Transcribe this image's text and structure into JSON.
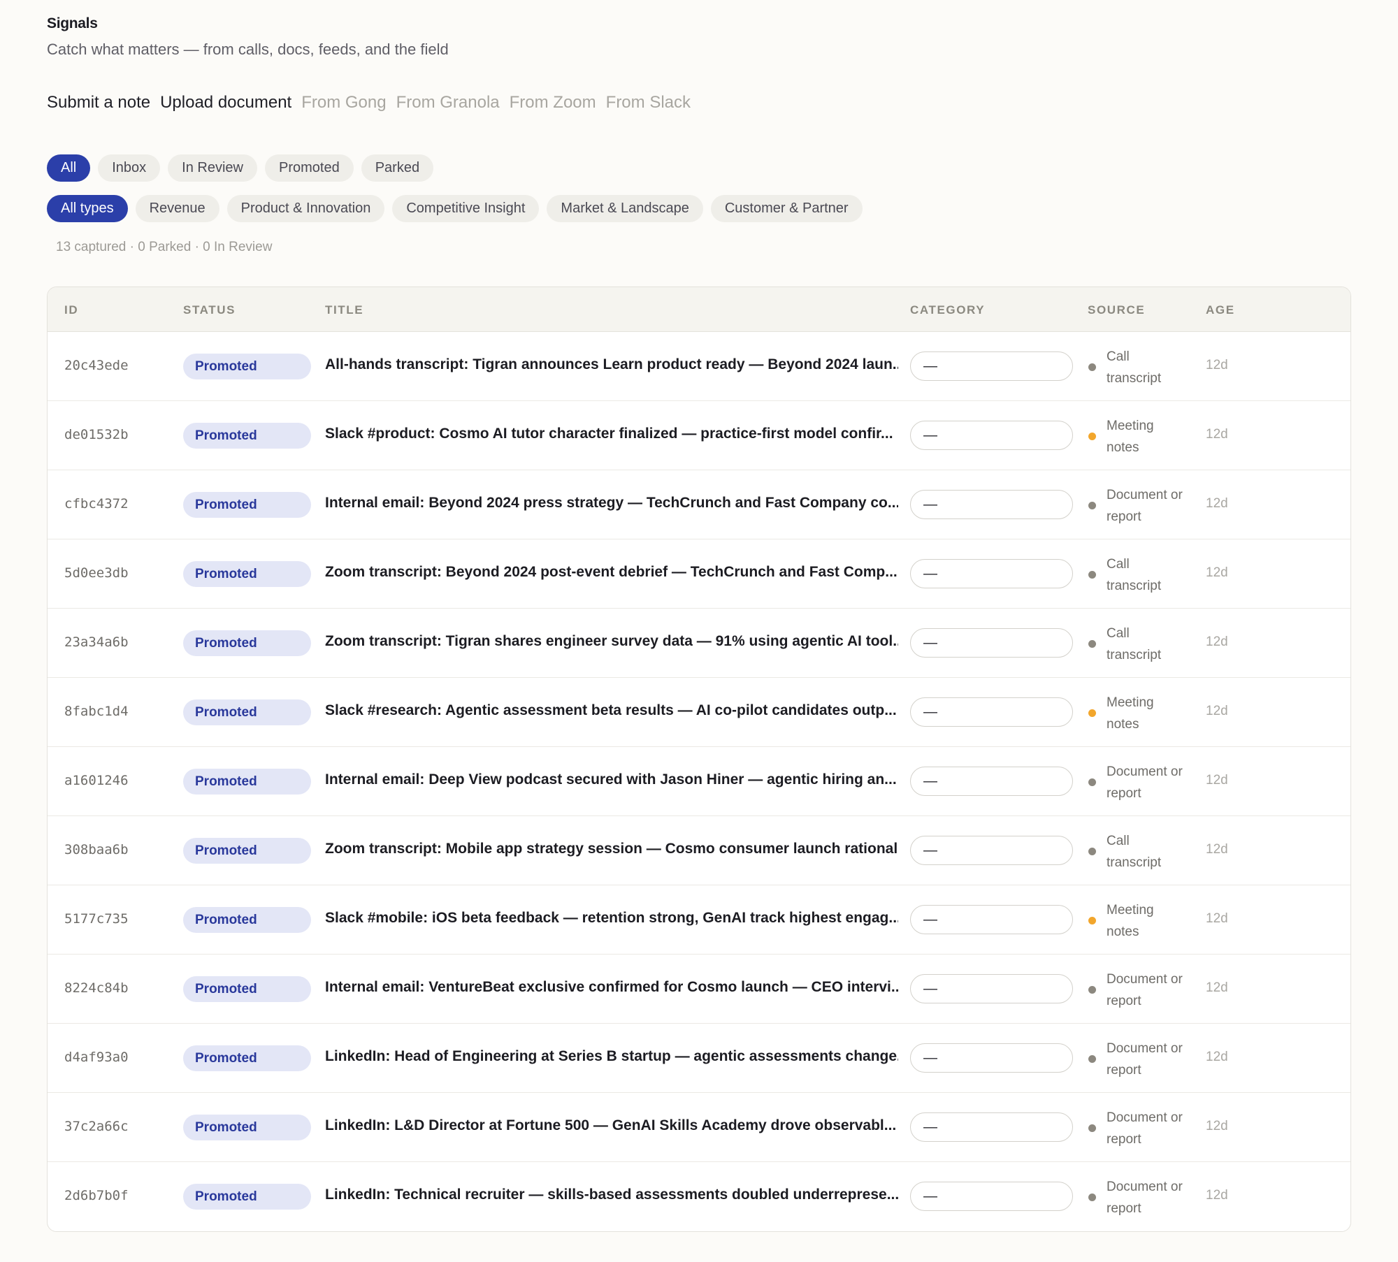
{
  "header": {
    "title": "Signals",
    "subtitle": "Catch what matters — from calls, docs, feeds, and the field"
  },
  "actions": [
    {
      "label": "Submit a note",
      "style": "primary"
    },
    {
      "label": "Upload document",
      "style": "primary"
    },
    {
      "label": "From Gong",
      "style": "muted"
    },
    {
      "label": "From Granola",
      "style": "muted"
    },
    {
      "label": "From Zoom",
      "style": "muted"
    },
    {
      "label": "From Slack",
      "style": "muted"
    }
  ],
  "status_filters": [
    {
      "label": "All",
      "active": true
    },
    {
      "label": "Inbox",
      "active": false
    },
    {
      "label": "In Review",
      "active": false
    },
    {
      "label": "Promoted",
      "active": false
    },
    {
      "label": "Parked",
      "active": false
    }
  ],
  "type_filters": [
    {
      "label": "All types",
      "active": true
    },
    {
      "label": "Revenue",
      "active": false
    },
    {
      "label": "Product & Innovation",
      "active": false
    },
    {
      "label": "Competitive Insight",
      "active": false
    },
    {
      "label": "Market & Landscape",
      "active": false
    },
    {
      "label": "Customer & Partner",
      "active": false
    }
  ],
  "counts": "13 captured · 0 Parked · 0 In Review",
  "colors": {
    "accent": "#2b3fa9",
    "badge_bg": "#e3e6f6",
    "dot_gray": "#8c887f",
    "dot_orange": "#f2a62c"
  },
  "table": {
    "columns": {
      "id": "ID",
      "status": "STATUS",
      "title": "TITLE",
      "category": "CATEGORY",
      "source": "SOURCE",
      "age": "AGE"
    },
    "rows": [
      {
        "id": "20c43ede",
        "status": "Promoted",
        "title": "All-hands transcript: Tigran announces Learn product ready — Beyond 2024 laun...",
        "category": "—",
        "source_line1": "Call",
        "source_line2": "transcript",
        "dot": "gray",
        "age": "12d"
      },
      {
        "id": "de01532b",
        "status": "Promoted",
        "title": "Slack #product: Cosmo AI tutor character finalized — practice-first model confir...",
        "category": "—",
        "source_line1": "Meeting",
        "source_line2": "notes",
        "dot": "orange",
        "age": "12d"
      },
      {
        "id": "cfbc4372",
        "status": "Promoted",
        "title": "Internal email: Beyond 2024 press strategy — TechCrunch and Fast Company co...",
        "category": "—",
        "source_line1": "Document or",
        "source_line2": "report",
        "dot": "gray",
        "age": "12d"
      },
      {
        "id": "5d0ee3db",
        "status": "Promoted",
        "title": "Zoom transcript: Beyond 2024 post-event debrief — TechCrunch and Fast Comp...",
        "category": "—",
        "source_line1": "Call",
        "source_line2": "transcript",
        "dot": "gray",
        "age": "12d"
      },
      {
        "id": "23a34a6b",
        "status": "Promoted",
        "title": "Zoom transcript: Tigran shares engineer survey data — 91% using agentic AI tool...",
        "category": "—",
        "source_line1": "Call",
        "source_line2": "transcript",
        "dot": "gray",
        "age": "12d"
      },
      {
        "id": "8fabc1d4",
        "status": "Promoted",
        "title": "Slack #research: Agentic assessment beta results — AI co-pilot candidates outp...",
        "category": "—",
        "source_line1": "Meeting",
        "source_line2": "notes",
        "dot": "orange",
        "age": "12d"
      },
      {
        "id": "a1601246",
        "status": "Promoted",
        "title": "Internal email: Deep View podcast secured with Jason Hiner — agentic hiring an...",
        "category": "—",
        "source_line1": "Document or",
        "source_line2": "report",
        "dot": "gray",
        "age": "12d"
      },
      {
        "id": "308baa6b",
        "status": "Promoted",
        "title": "Zoom transcript: Mobile app strategy session — Cosmo consumer launch rational...",
        "category": "—",
        "source_line1": "Call",
        "source_line2": "transcript",
        "dot": "gray",
        "age": "12d"
      },
      {
        "id": "5177c735",
        "status": "Promoted",
        "title": "Slack #mobile: iOS beta feedback — retention strong, GenAI track highest engag...",
        "category": "—",
        "source_line1": "Meeting",
        "source_line2": "notes",
        "dot": "orange",
        "age": "12d"
      },
      {
        "id": "8224c84b",
        "status": "Promoted",
        "title": "Internal email: VentureBeat exclusive confirmed for Cosmo launch — CEO intervi...",
        "category": "—",
        "source_line1": "Document or",
        "source_line2": "report",
        "dot": "gray",
        "age": "12d"
      },
      {
        "id": "d4af93a0",
        "status": "Promoted",
        "title": "LinkedIn: Head of Engineering at Series B startup — agentic assessments change...",
        "category": "—",
        "source_line1": "Document or",
        "source_line2": "report",
        "dot": "gray",
        "age": "12d"
      },
      {
        "id": "37c2a66c",
        "status": "Promoted",
        "title": "LinkedIn: L&D Director at Fortune 500 — GenAI Skills Academy drove observabl...",
        "category": "—",
        "source_line1": "Document or",
        "source_line2": "report",
        "dot": "gray",
        "age": "12d"
      },
      {
        "id": "2d6b7b0f",
        "status": "Promoted",
        "title": "LinkedIn: Technical recruiter — skills-based assessments doubled underreprese...",
        "category": "—",
        "source_line1": "Document or",
        "source_line2": "report",
        "dot": "gray",
        "age": "12d"
      }
    ]
  }
}
